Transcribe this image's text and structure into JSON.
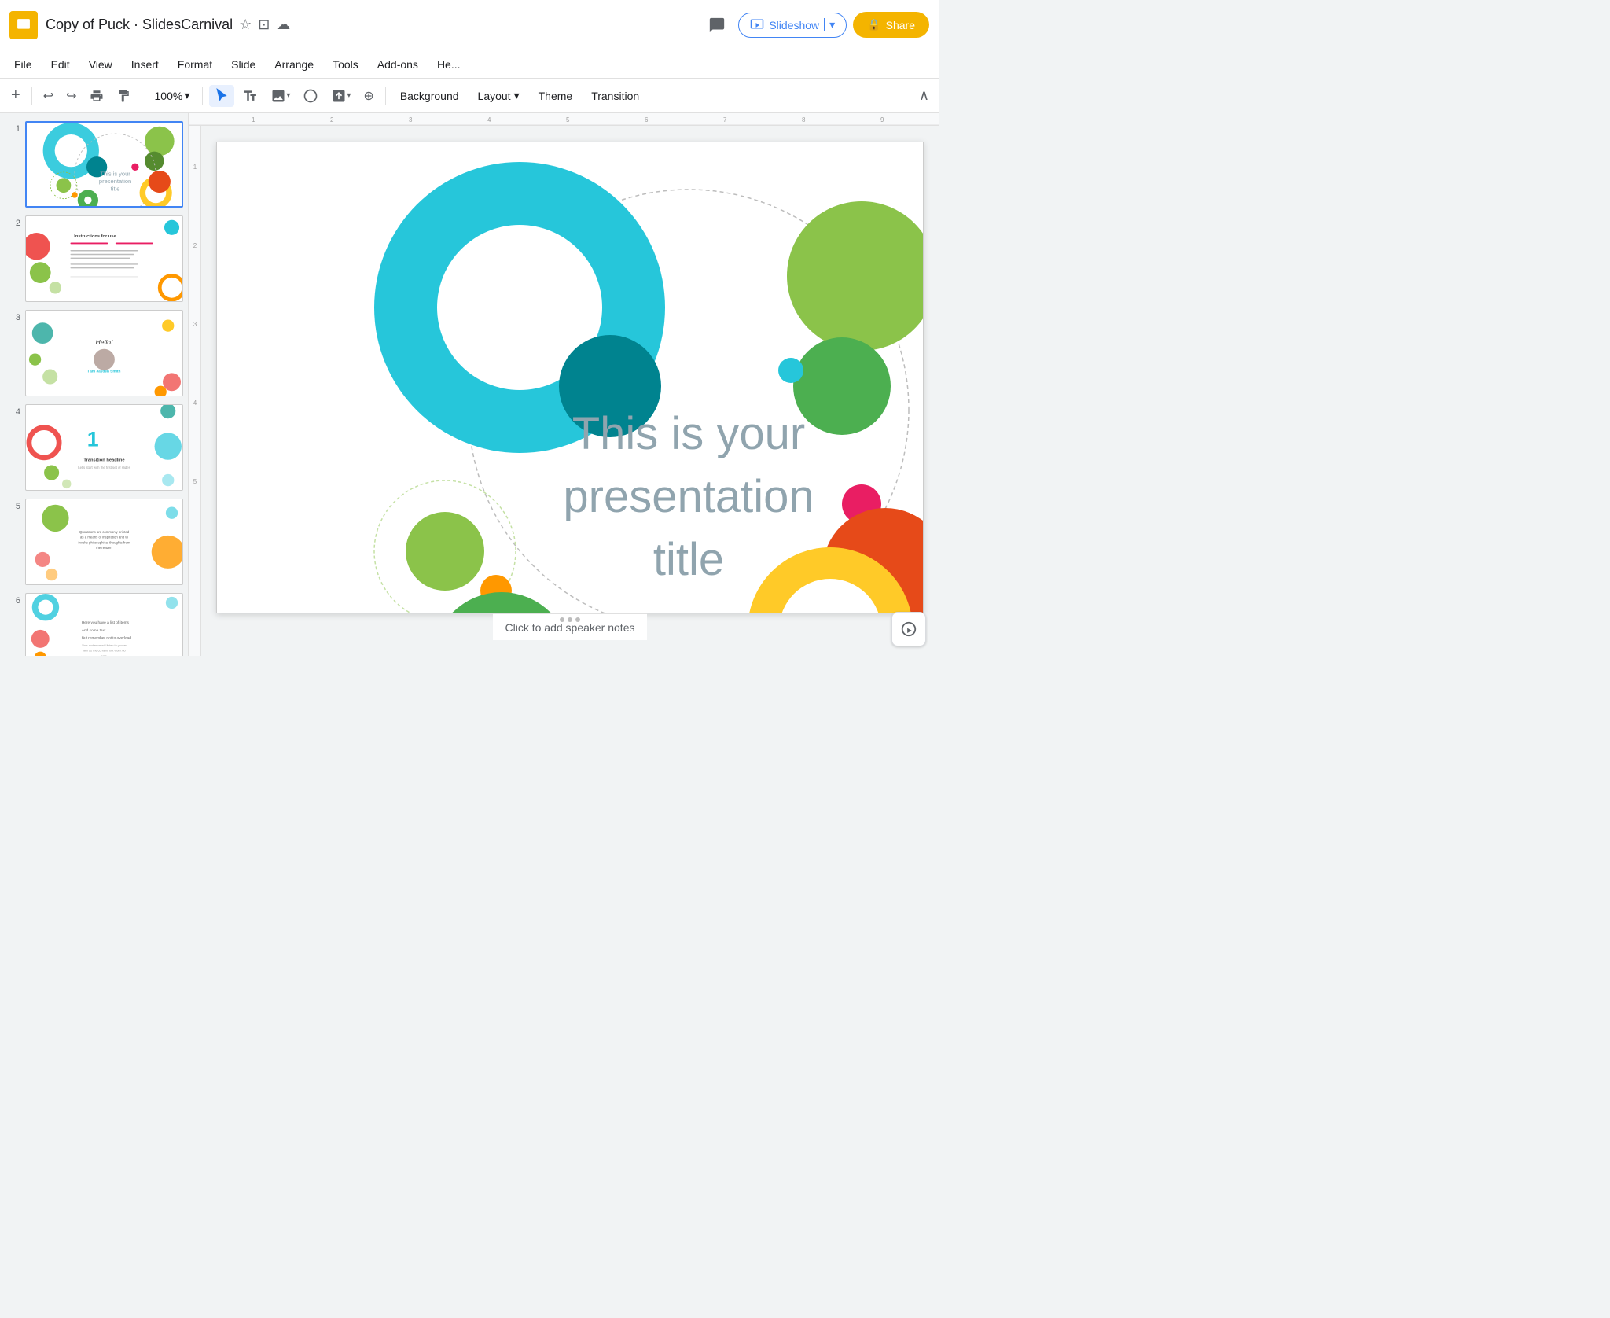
{
  "app": {
    "icon_color": "#f4b400",
    "doc_title": "Copy of Puck · SlidesCarnival",
    "star_icon": "★",
    "bookmark_icon": "⊡",
    "cloud_icon": "☁"
  },
  "header": {
    "comment_icon": "💬",
    "present_label": "Slideshow",
    "share_label": "Share",
    "share_icon": "🔒",
    "dropdown_arrow": "▾"
  },
  "menu": {
    "items": [
      "File",
      "Edit",
      "View",
      "Insert",
      "Format",
      "Slide",
      "Arrange",
      "Tools",
      "Add-ons",
      "He..."
    ]
  },
  "toolbar": {
    "add_label": "+",
    "undo_icon": "↩",
    "redo_icon": "↪",
    "print_icon": "🖨",
    "paintformat_icon": "🖌",
    "zoom_label": "100%",
    "zoom_icon": "▾",
    "select_icon": "↖",
    "textbox_icon": "T",
    "image_icon": "🖼",
    "shape_icon": "⬟",
    "line_icon": "╱",
    "line_arrow": "▾",
    "plus_icon": "⊕",
    "background_label": "Background",
    "layout_label": "Layout",
    "layout_arrow": "▾",
    "theme_label": "Theme",
    "transition_label": "Transition",
    "collapse_icon": "∧"
  },
  "slides": [
    {
      "num": "1",
      "active": true,
      "title_text": "This is your presentation title"
    },
    {
      "num": "2",
      "active": false,
      "title_text": "Instructions for use"
    },
    {
      "num": "3",
      "active": false,
      "title_text": "Hello!"
    },
    {
      "num": "4",
      "active": false,
      "title_text": "1"
    },
    {
      "num": "5",
      "active": false,
      "title_text": ""
    },
    {
      "num": "6",
      "active": false,
      "title_text": ""
    }
  ],
  "main_slide": {
    "title": "This is your presentation title"
  },
  "speaker_notes": {
    "placeholder": "Click to add speaker notes"
  },
  "bottom_bar": {
    "grid_icon": "⊞",
    "list_icon": "≡",
    "collapse_icon": "❮"
  },
  "fab": {
    "icon": "✦"
  }
}
